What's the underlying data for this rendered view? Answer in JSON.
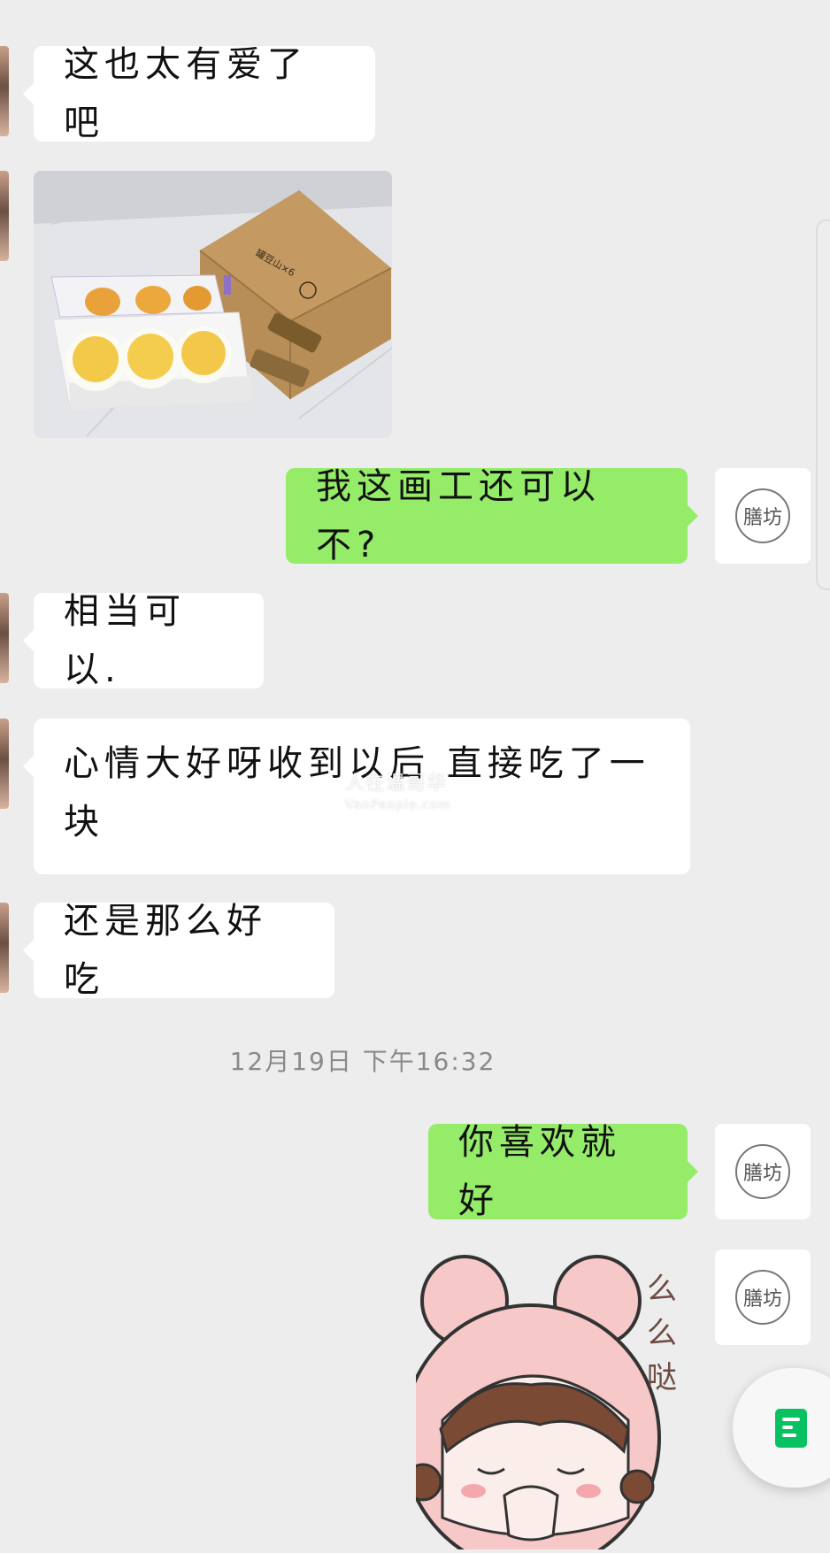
{
  "messages": [
    {
      "side": "in",
      "text": "这也太有爱了吧"
    },
    {
      "side": "in",
      "type": "image",
      "alt": "photo"
    },
    {
      "side": "out",
      "text": "我这画工还可以不?"
    },
    {
      "side": "in",
      "text": "相当可以."
    },
    {
      "side": "in",
      "line1": "心情大好呀收到以后 直接吃了一",
      "line2": "块"
    },
    {
      "side": "in",
      "text": "还是那么好吃"
    },
    {
      "side": "out",
      "text": "你喜欢就好"
    },
    {
      "side": "out",
      "type": "sticker",
      "caption": "么么哒"
    }
  ],
  "timestamp": "12月19日 下午16:32",
  "box_label": "罐豆山×6",
  "avatar_logo_text": "膳坊",
  "watermark": {
    "line1": "人在温哥华",
    "line2": "VanPeople.com"
  },
  "colors": {
    "background": "#ededed",
    "outgoing_bubble": "#95ec69",
    "incoming_bubble": "#ffffff",
    "float_icon": "#08c160"
  },
  "icons": {
    "float_button": "document-icon"
  }
}
